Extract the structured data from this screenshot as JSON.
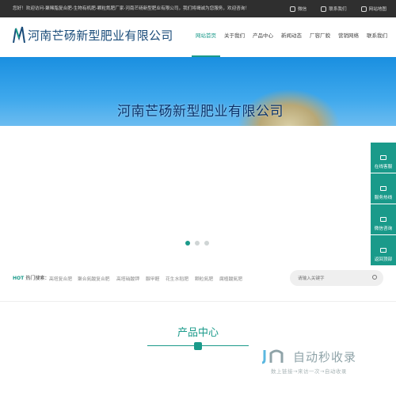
{
  "topbar": {
    "welcome": "您好！欢迎访问-聚稀脂复合肥-生物有机肥-颗粒氮肥厂家-河南芒砀新型肥业有限公司，我们将竭诚为您服务，欢迎咨询！",
    "links": [
      "微信",
      "联系我们",
      "网站地图"
    ]
  },
  "header": {
    "company_name": "河南芒砀新型肥业有限公司",
    "nav": [
      "网站首页",
      "关于我们",
      "产品中心",
      "新闻动态",
      "厂容厂貌",
      "营销网络",
      "联系我们"
    ]
  },
  "banner": {
    "title": "河南芒砀新型肥业有限公司"
  },
  "carousel": {
    "slide_count": 3,
    "active_index": 0
  },
  "side_float": [
    "在线客服",
    "服务热线",
    "微信咨询",
    "返回顶部"
  ],
  "hot_search": {
    "label_hot": "HOT",
    "label": "热门搜索：",
    "keywords": [
      "高塔复合肥",
      "聚合氮酸复合肥",
      "高塔硝酸钾",
      "脲甲醛",
      "花生水稻肥",
      "颗粒氮肥",
      "腐植酸氮肥"
    ]
  },
  "search": {
    "placeholder": "请输入关键字"
  },
  "product_center": {
    "title": "产品中心"
  },
  "watermark": {
    "big": "自动秒收录",
    "small": "数上链接→来访一次→自动收录"
  },
  "colors": {
    "accent": "#1a9a8a",
    "topbar": "#2f2f2f",
    "logo_text": "#1a4c7a"
  }
}
